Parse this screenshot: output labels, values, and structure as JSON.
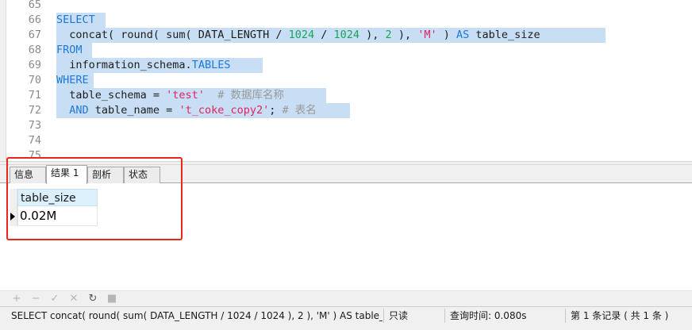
{
  "editor": {
    "line_numbers": [
      "65",
      "66",
      "67",
      "68",
      "69",
      "70",
      "71",
      "72",
      "73",
      "74",
      "75"
    ],
    "line66_kw": "SELECT",
    "line67": {
      "p1": "  concat( round( sum( DATA_LENGTH / ",
      "n1": "1024",
      "p2": " / ",
      "n2": "1024",
      "p3": " ), ",
      "n3": "2",
      "p4": " ), ",
      "s1": "'M'",
      "p5": " ) ",
      "kw": "AS",
      "p6": " table_size"
    },
    "line68_kw": "FROM",
    "line69": {
      "p1": "  information_schema.",
      "kw": "TABLES"
    },
    "line70_kw": "WHERE",
    "line71": {
      "p1": "  table_schema = ",
      "s1": "'test'",
      "cmt": "  # 数据库名称"
    },
    "line72": {
      "kw": "  AND",
      "p1": " table_name = ",
      "s1": "'t_coke_copy2'",
      "p2": "; ",
      "cmt": "# 表名"
    }
  },
  "result_tabs": [
    "信息",
    "结果 1",
    "剖析",
    "状态"
  ],
  "result_grid": {
    "column": "table_size",
    "value": "0.02M"
  },
  "toolbar_icons": [
    "plus-icon",
    "minus-icon",
    "check-icon",
    "cross-icon",
    "refresh-icon",
    "stop-icon"
  ],
  "toolbar_glyphs": {
    "add": "+",
    "remove": "−",
    "apply": "✓",
    "cancel": "✕",
    "refresh": "↻",
    "stop": "■"
  },
  "status": {
    "query": "SELECT    concat( round( sum( DATA_LENGTH / 1024 / 1024 ), 2 ), 'M' ) AS table_size",
    "readonly": "只读",
    "query_time": "查询时间: 0.080s",
    "records": "第 1 条记录 ( 共 1 条 )"
  },
  "colors": {
    "keyword": "#1e78d8",
    "number": "#19a45a",
    "string": "#e0245e",
    "comment": "#999999",
    "selection": "#c8def4",
    "annotation": "#e8261c"
  }
}
